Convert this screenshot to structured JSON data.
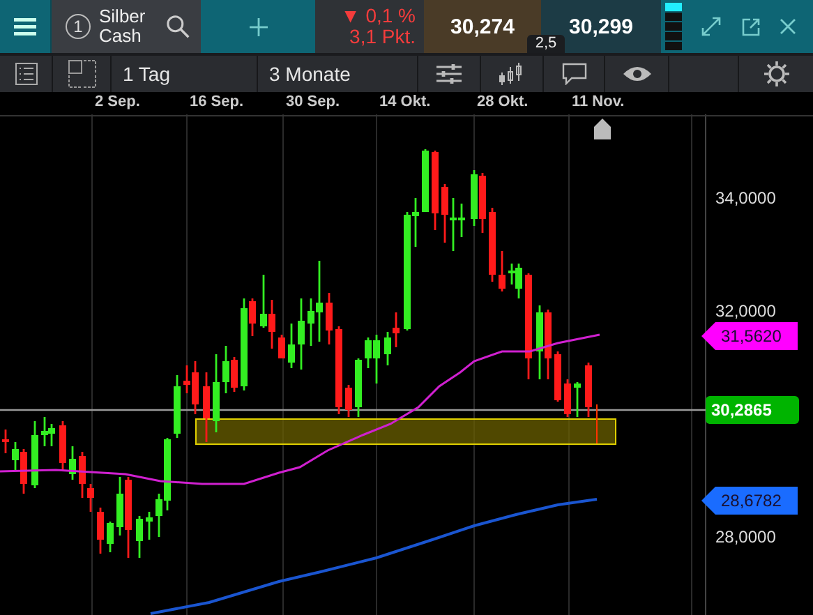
{
  "top_bar": {
    "instrument_number": "1",
    "instrument": "Silber Cash",
    "change": {
      "arrow": "▼",
      "percent": "0,1 %",
      "points": "3,1 Pkt."
    },
    "sell": "30,274",
    "buy": "30,299",
    "spread": "2,5"
  },
  "toolbar": {
    "interval": "1 Tag",
    "range": "3 Monate"
  },
  "dates": [
    "2 Sep.",
    "16 Sep.",
    "30 Sep.",
    "14 Okt.",
    "28 Okt.",
    "11 Nov."
  ],
  "y_axis": [
    "34,0000",
    "32,0000",
    "28,0000"
  ],
  "price_tags": [
    {
      "value": "31,5620",
      "color": "#ff00ff",
      "kind": "arrow"
    },
    {
      "value": "30,2865",
      "color": "#00b400",
      "kind": "current"
    },
    {
      "value": "28,6782",
      "color": "#1a6cff",
      "kind": "arrow"
    }
  ]
}
